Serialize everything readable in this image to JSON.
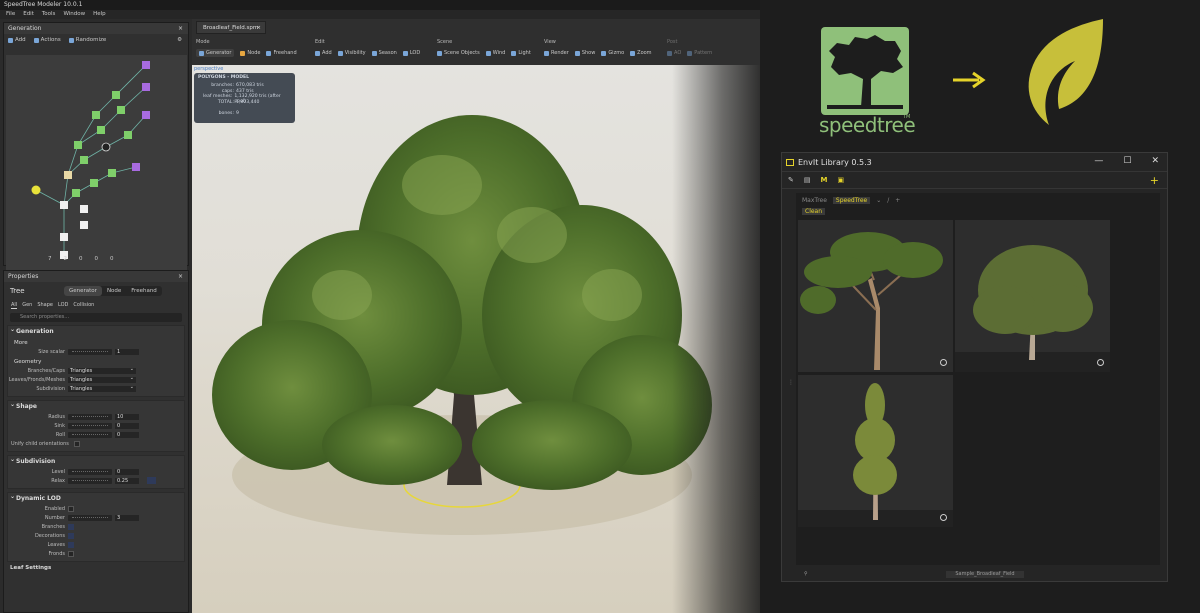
{
  "modeler": {
    "title": "SpeedTree  Modeler  10.0.1",
    "menu": [
      "File",
      "Edit",
      "Tools",
      "Window",
      "Help"
    ],
    "generation_panel": {
      "title": "Generation",
      "close": "×",
      "toolbar": {
        "add": "Add",
        "actions": "Actions",
        "randomize": "Randomize"
      },
      "footer": [
        "7",
        "2",
        "0",
        "0",
        "0"
      ]
    },
    "properties_panel": {
      "title": "Properties",
      "close": "×",
      "object": "Tree",
      "modes": [
        "Generator",
        "Node",
        "Freehand"
      ],
      "subtabs": [
        "All",
        "Gen",
        "Shape",
        "LOD",
        "Collision"
      ],
      "search_placeholder": "Search properties...",
      "generation": {
        "title": "Generation",
        "more": "More",
        "size_scalar_label": "Size scalar",
        "size_scalar_value": "1",
        "geometry": "Geometry",
        "branches_label": "Branches/Caps",
        "branches_value": "Triangles",
        "leaves_label": "Leaves/Fronds/Meshes",
        "leaves_value": "Triangles",
        "subdivision_label": "Subdivision",
        "subdivision_value": "Triangles"
      },
      "shape": {
        "title": "Shape",
        "radius_label": "Radius",
        "radius_value": "10",
        "sink_label": "Sink",
        "sink_value": "0",
        "roll_label": "Roll",
        "roll_value": "0",
        "unify_label": "Unify child orientations"
      },
      "subdivision": {
        "title": "Subdivision",
        "level_label": "Level",
        "level_value": "0",
        "relax_label": "Relax",
        "relax_value": "0.25"
      },
      "dynamic_lod": {
        "title": "Dynamic LOD",
        "enabled_label": "Enabled",
        "number_label": "Number",
        "number_value": "3",
        "branches_label": "Branches",
        "decorations_label": "Decorations",
        "leaves_label": "Leaves",
        "fronds_label": "Fronds"
      },
      "leaf_settings": "Leaf Settings"
    },
    "document_tab": "Broadleaf_Field.spm",
    "toolbar": {
      "mode": {
        "label": "Mode",
        "buttons": [
          "Generator",
          "Node",
          "Freehand"
        ]
      },
      "edit": {
        "label": "Edit",
        "buttons": [
          "Add",
          "Visibility",
          "Season",
          "LOD"
        ]
      },
      "scene": {
        "label": "Scene",
        "buttons": [
          "Scene Objects",
          "Wind",
          "Light"
        ]
      },
      "view": {
        "label": "View",
        "buttons": [
          "Render",
          "Show",
          "Gizmo",
          "Zoom"
        ]
      },
      "post": {
        "label": "Post",
        "buttons": [
          "AO",
          "Pattern"
        ]
      }
    },
    "viewport": {
      "label": "perspective",
      "stats_title": "POLYGONS - MODEL",
      "stats": [
        {
          "k": "branches:",
          "v": "670,083 tris"
        },
        {
          "k": "caps:",
          "v": "437 tris"
        },
        {
          "k": "leaf meshes:",
          "v": "1,132,920 tris (after pool)"
        },
        {
          "k": "TOTAL:",
          "v": "1,803,440"
        },
        {
          "k": "",
          "v": ""
        },
        {
          "k": "bones:",
          "v": "9"
        }
      ]
    }
  },
  "logos": {
    "speedtree_word": "speedtree",
    "tm": "TM",
    "arrow": "→"
  },
  "library": {
    "title": "EnvIt Library 0.5.3",
    "window_buttons": [
      "—",
      "☐",
      "✕"
    ],
    "crumbs": [
      "MaxTree",
      "SpeedTree",
      "⌄",
      "/",
      "+"
    ],
    "tag": "Clean",
    "status_file": "Sample_Broadleaf_Field"
  },
  "colors": {
    "accent_yellow": "#e5d32a",
    "speedtree_green": "#8fc07a",
    "envit_logo": "#c7bf3a",
    "viewport_label": "#4a7cc2"
  }
}
